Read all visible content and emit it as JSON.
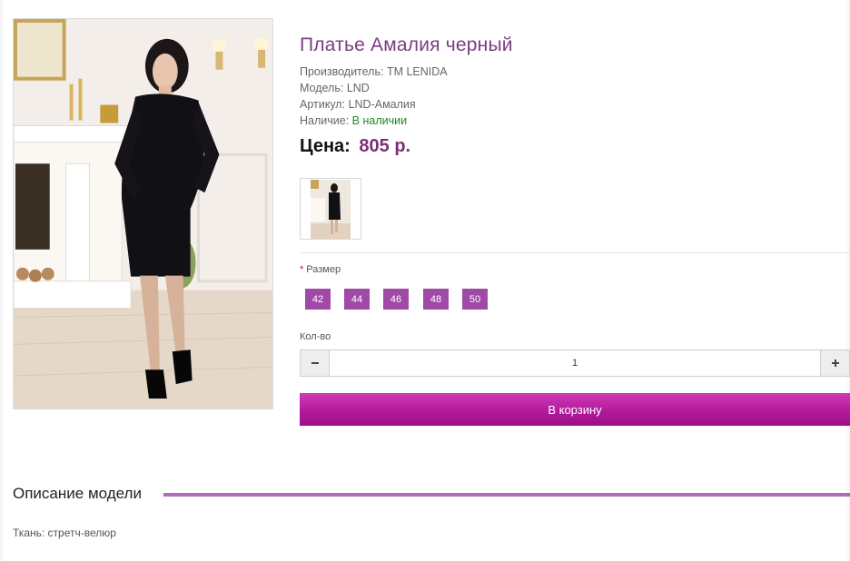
{
  "product": {
    "title": "Платье Амалия черный",
    "manufacturer_label": "Производитель:",
    "manufacturer_value": "TM LENIDA",
    "model_label": "Модель:",
    "model_value": "LND",
    "sku_label": "Артикул:",
    "sku_value": "LND-Амалия",
    "availability_label": "Наличие:",
    "availability_value": "В наличии",
    "price_label": "Цена:",
    "price_value": "805 р."
  },
  "options": {
    "size_required_mark": "*",
    "size_label": "Размер",
    "sizes": [
      "42",
      "44",
      "46",
      "48",
      "50"
    ],
    "qty_label": "Кол-во",
    "qty_value": "1",
    "minus_icon": "minus-icon",
    "plus_icon": "plus-icon"
  },
  "cart": {
    "button_label": "В корзину"
  },
  "description": {
    "heading": "Описание модели",
    "text": "Ткань: стретч-велюр"
  },
  "colors": {
    "accent_purple": "#a04aa8",
    "title_purple": "#7a3d82",
    "cart_magenta": "#b21a9c",
    "in_stock_green": "#1e8a1e"
  }
}
